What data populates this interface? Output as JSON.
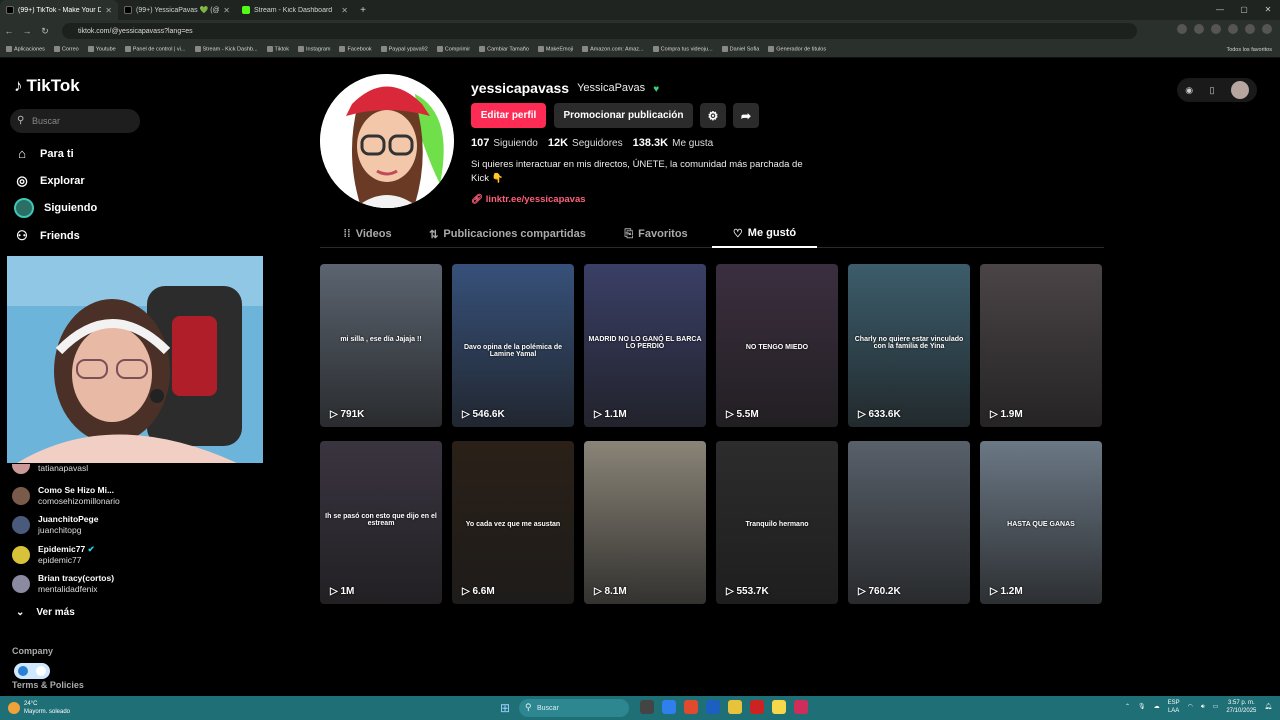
{
  "browser": {
    "tabs": [
      {
        "title": "(99+) TikTok - Make Your Day",
        "favicon": "tiktok"
      },
      {
        "title": "(99+) YessicaPavas 💚 (@yessi",
        "favicon": "tiktok"
      },
      {
        "title": "Stream - Kick Dashboard",
        "favicon": "kick"
      }
    ],
    "url": "tiktok.com/@yessicapavass?lang=es",
    "bookmarks": [
      "Aplicaciones",
      "Correo",
      "Youtube",
      "Panel de control | vi...",
      "Stream - Kick Dashb...",
      "Tiktok",
      "Instagram",
      "Facebook",
      "Paypal ypava92",
      "Comprimir",
      "Cambiar Tamaño",
      "MakeEmoji",
      "Amazon.com: Amaz...",
      "Compra tus videoju...",
      "Daniel Sofia",
      "Generador de titulos"
    ],
    "bookmarks_right": "Todos los favoritos"
  },
  "sidebar": {
    "logo": "TikTok",
    "search_placeholder": "Buscar",
    "nav": [
      {
        "label": "Para ti",
        "icon": "home-icon"
      },
      {
        "label": "Explorar",
        "icon": "compass-icon"
      },
      {
        "label": "Siguiendo",
        "icon": "following-avatar"
      },
      {
        "label": "Friends",
        "icon": "friends-icon"
      }
    ],
    "following": [
      {
        "name": "",
        "handle": "tatianapavasl"
      },
      {
        "name": "Como Se Hizo Mi...",
        "handle": "comosehizomillonario"
      },
      {
        "name": "JuanchitoPege",
        "handle": "juanchitopg"
      },
      {
        "name": "Epidemic77",
        "handle": "epidemic77"
      },
      {
        "name": "Brian tracy(cortos)",
        "handle": "mentalidadfenix"
      }
    ],
    "see_more": "Ver más",
    "company": "Company",
    "terms": "Terms & Policies"
  },
  "profile": {
    "username": "yessicapavass",
    "nickname": "YessicaPavas",
    "edit_button": "Editar perfil",
    "promote_button": "Promocionar publicación",
    "following_count": "107",
    "following_label": "Siguiendo",
    "followers_count": "12K",
    "followers_label": "Seguidores",
    "likes_count": "138.3K",
    "likes_label": "Me gusta",
    "bio_line1": "Si quieres interactuar en mis directos, ÚNETE, la comunidad más parchada de",
    "bio_line2": "Kick 👇",
    "link": "linktr.ee/yessicapavas"
  },
  "tabs": [
    {
      "label": "Videos",
      "icon": "grid-icon",
      "active": false
    },
    {
      "label": "Publicaciones compartidas",
      "icon": "repost-icon",
      "active": false
    },
    {
      "label": "Favoritos",
      "icon": "bookmark-icon",
      "active": false
    },
    {
      "label": "Me gustó",
      "icon": "heart-icon",
      "active": true
    }
  ],
  "videos": [
    {
      "views": "791K",
      "caption": "mi silla , ese día Jajaja !!",
      "color": "#5b6470"
    },
    {
      "views": "546.6K",
      "caption": "Davo opina de la polémica de Lamine Yamal",
      "color": "#37517a"
    },
    {
      "views": "1.1M",
      "caption": "MADRID NO LO GANÓ EL BARCA LO PERDIÓ",
      "color": "#3a3f66"
    },
    {
      "views": "5.5M",
      "caption": "NO TENGO MIEDO",
      "color": "#3b2f3f"
    },
    {
      "views": "633.6K",
      "caption": "Charly no quiere estar vinculado con la familia de Yina",
      "color": "#3c5d6c"
    },
    {
      "views": "1.9M",
      "caption": "",
      "color": "#4a4446"
    },
    {
      "views": "1M",
      "caption": "Ih se pasó con esto que dijo en el estream",
      "color": "#3a3440"
    },
    {
      "views": "6.6M",
      "caption": "Yo cada vez que me asustan",
      "color": "#2a2018"
    },
    {
      "views": "8.1M",
      "caption": "",
      "color": "#8a8478"
    },
    {
      "views": "553.7K",
      "caption": "Tranquilo hermano",
      "color": "#2c2c2c"
    },
    {
      "views": "760.2K",
      "caption": "",
      "color": "#58606a"
    },
    {
      "views": "1.2M",
      "caption": "HASTA QUE GANAS",
      "color": "#6b7885"
    }
  ],
  "taskbar": {
    "weather_temp": "24°C",
    "weather_desc": "Mayorm. soleado",
    "search": "Buscar",
    "lang": "ESP",
    "lang2": "LAA",
    "time": "3:57 p. m.",
    "date": "27/10/2025"
  }
}
